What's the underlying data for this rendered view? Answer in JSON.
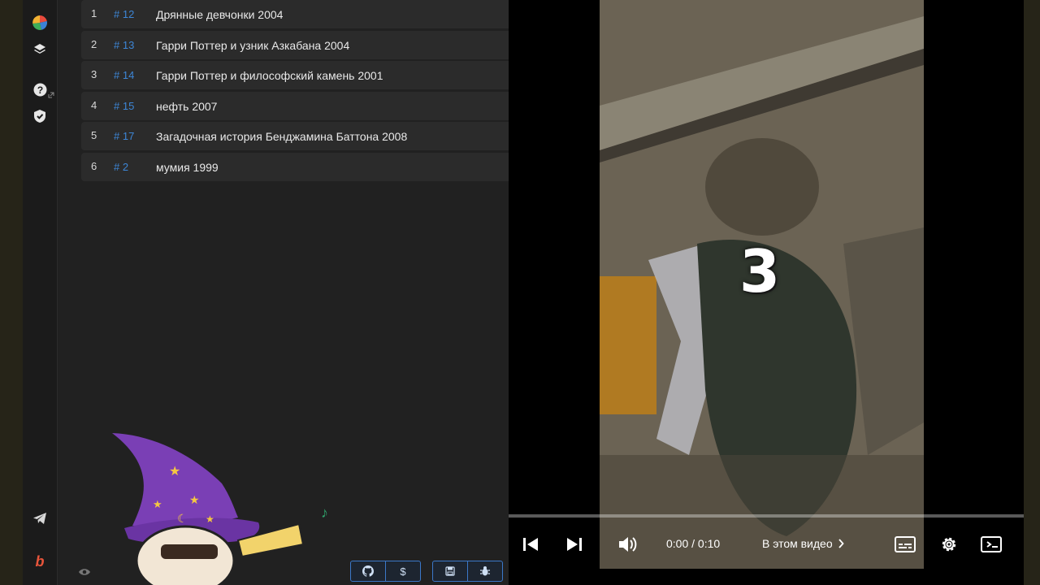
{
  "list": {
    "items": [
      {
        "num": "1",
        "tag": "# 12",
        "title": "Дрянные девчонки 2004"
      },
      {
        "num": "2",
        "tag": "# 13",
        "title": "Гарри Поттер и узник Азкабана 2004"
      },
      {
        "num": "3",
        "tag": "# 14",
        "title": "Гарри Поттер и философский камень 2001"
      },
      {
        "num": "4",
        "tag": "# 15",
        "title": "нефть 2007"
      },
      {
        "num": "5",
        "tag": "# 17",
        "title": "Загадочная история Бенджамина Баттона 2008"
      },
      {
        "num": "6",
        "tag": "# 2",
        "title": "мумия 1999"
      }
    ]
  },
  "sidebar": {
    "icons": [
      "pie-chart-icon",
      "layers-icon",
      "help-icon",
      "shield-check-icon",
      "telegram-icon",
      "brand-b-icon"
    ]
  },
  "toolbar": {
    "dollar_label": "$",
    "icons": [
      "github-icon",
      "dollar-icon",
      "save-icon",
      "bug-icon"
    ]
  },
  "colors": {
    "tag_blue": "#3d86d6",
    "row_bg": "#2b2b2b",
    "app_bg": "#212121",
    "toolbar_border": "#3b78c9"
  },
  "player": {
    "overlay_number": "3",
    "time": "0:00 / 0:10",
    "chapters_label": "В этом видео",
    "progress": 0.0,
    "controls": [
      "previous-icon",
      "next-icon",
      "volume-icon",
      "subtitles-icon",
      "settings-icon",
      "miniplayer-icon"
    ]
  }
}
